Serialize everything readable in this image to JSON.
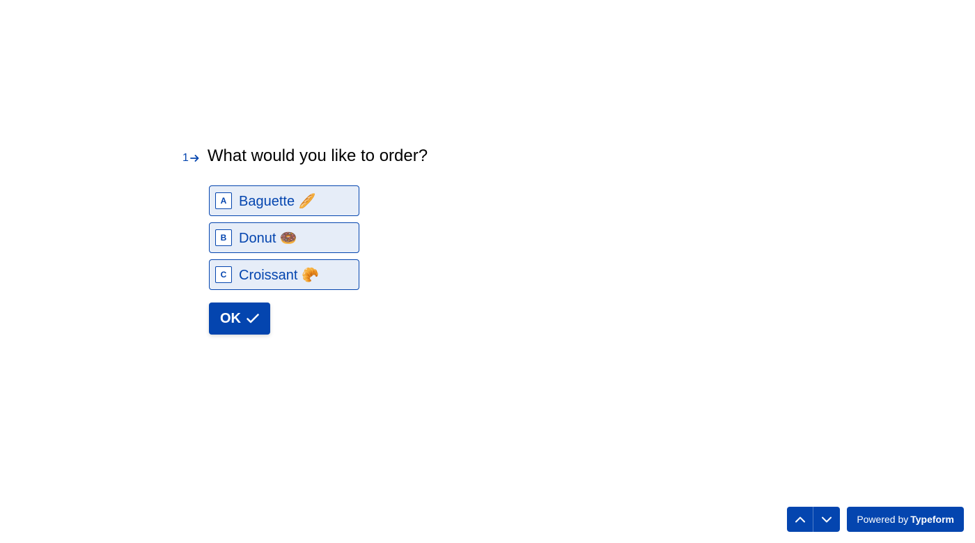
{
  "question": {
    "number": "1",
    "text": "What would you like to order?"
  },
  "options": [
    {
      "key": "A",
      "label": "Baguette 🥖"
    },
    {
      "key": "B",
      "label": "Donut 🍩"
    },
    {
      "key": "C",
      "label": "Croissant 🥐"
    }
  ],
  "ok_button": "OK",
  "footer": {
    "powered_prefix": "Powered by",
    "powered_brand": "Typeform"
  }
}
